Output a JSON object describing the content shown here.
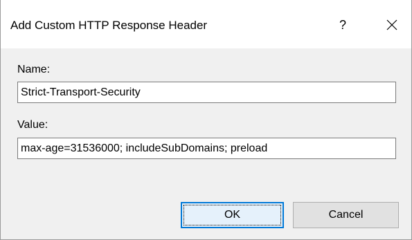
{
  "window": {
    "title": "Add Custom HTTP Response Header",
    "help_glyph": "?",
    "close_glyph": "✕"
  },
  "form": {
    "name_label": "Name:",
    "name_value": "Strict-Transport-Security",
    "value_label": "Value:",
    "value_value": "max-age=31536000; includeSubDomains; preload"
  },
  "buttons": {
    "ok_label": "OK",
    "cancel_label": "Cancel"
  },
  "colors": {
    "dialog_bg": "#f0f0f0",
    "titlebar_bg": "#ffffff",
    "default_button_border": "#0078d7"
  }
}
